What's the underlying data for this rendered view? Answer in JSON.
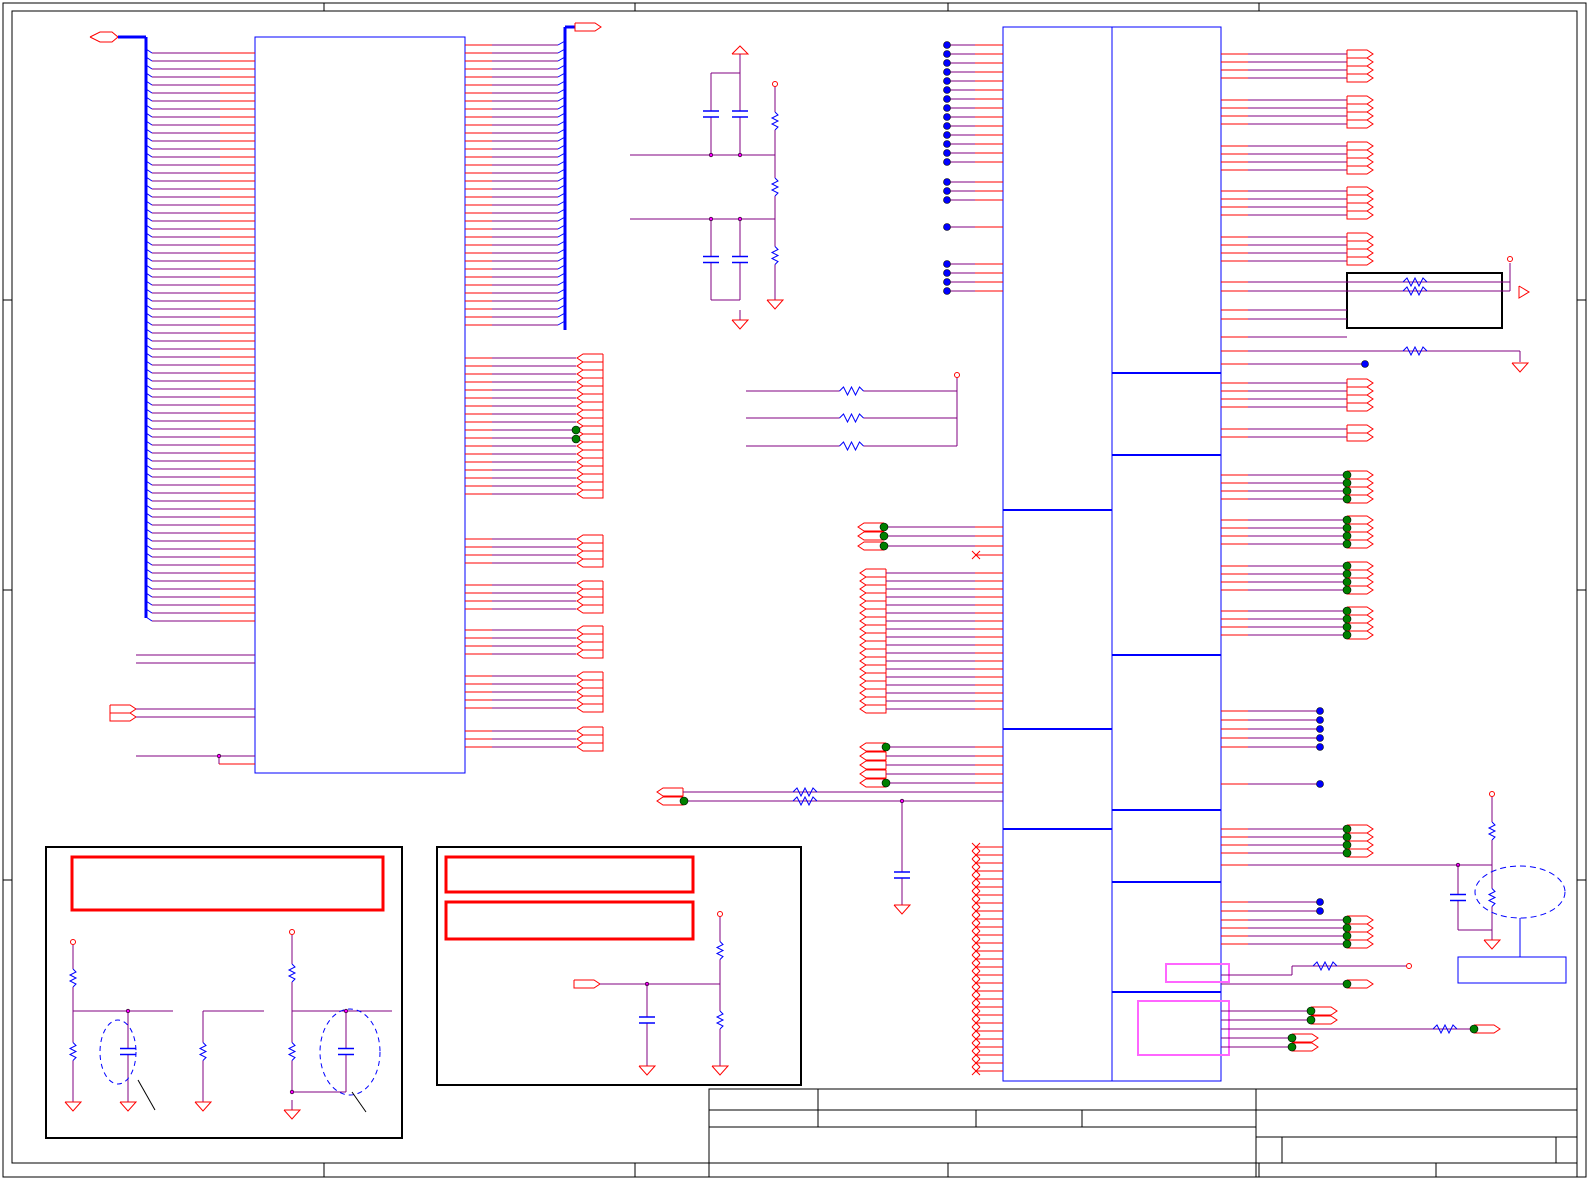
{
  "schematic": {
    "colors": {
      "wire": "#800080",
      "pin": "#ff0000",
      "bus": "#0000ff",
      "part": "#0000ff",
      "frame": "#000000",
      "note_box": "#ff0000",
      "dot_blue": "#0000ff",
      "dot_green": "#008000",
      "junction": "#ff00ff",
      "highlight": "#ff66ff"
    },
    "texts": []
  }
}
